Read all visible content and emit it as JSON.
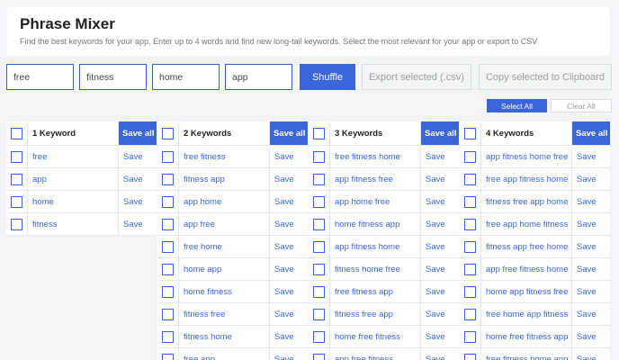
{
  "app": {
    "title": "Phrase Mixer",
    "subtitle": "Find the best keywords for your app. Enter up to 4 words and find new long-tail keywords. Select the most relevant for your app or export to CSV"
  },
  "inputs": [
    "free",
    "fitness",
    "home",
    "app"
  ],
  "toolbar": {
    "shuffle_label": "Shuffle",
    "export_label": "Export selected (.csv)",
    "clipboard_label": "Copy selected to Clipboard",
    "select_all_label": "Select All",
    "clear_all_label": "Clear All"
  },
  "save_label": "Save",
  "save_all_label": "Save all",
  "columns": [
    {
      "header": "1 Keyword",
      "keywords": [
        "free",
        "app",
        "home",
        "fitness"
      ]
    },
    {
      "header": "2 Keywords",
      "keywords": [
        "free fitness",
        "fitness app",
        "app home",
        "app free",
        "free home",
        "home app",
        "home fitness",
        "fitness free",
        "fitness home",
        "free app"
      ]
    },
    {
      "header": "3 Keywords",
      "keywords": [
        "free fitness home",
        "app fitness free",
        "app home free",
        "home fitness app",
        "app fitness home",
        "fitness home free",
        "free fitness app",
        "fitness free app",
        "home free fitness",
        "app free fitness"
      ]
    },
    {
      "header": "4 Keywords",
      "keywords": [
        "app fitness home free",
        "free app fitness home",
        "fitness free app home",
        "free app home fitness",
        "fitness app free home",
        "app free fitness home",
        "home app fitness free",
        "free home app fitness",
        "home free fitness app",
        "free fitness home app"
      ]
    }
  ]
}
